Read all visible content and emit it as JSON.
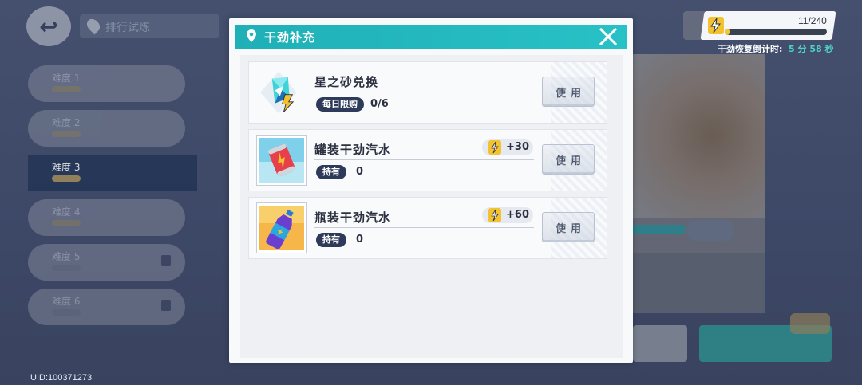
{
  "background": {
    "location_title": "排行试炼",
    "levels": [
      {
        "label": "难度 1",
        "locked": false
      },
      {
        "label": "难度 2",
        "locked": false
      },
      {
        "label": "难度 3",
        "locked": false,
        "active": true
      },
      {
        "label": "难度 4",
        "locked": false
      },
      {
        "label": "难度 5",
        "locked": true
      },
      {
        "label": "难度 6",
        "locked": true
      }
    ],
    "uid": "UID:100371273"
  },
  "stamina": {
    "value": "11/240",
    "fill_fraction": 0.046,
    "timer_label": "干劲恢复倒计时:",
    "timer_value": "5 分 58 秒"
  },
  "modal": {
    "title": "干劲补充",
    "items": [
      {
        "name": "星之砂兑换",
        "icon": "star-sand-crystal-icon",
        "tag": "每日限购",
        "count": "0/6",
        "gain": null,
        "button": "使用"
      },
      {
        "name": "罐装干劲汽水",
        "icon": "canned-soda-icon",
        "tag": "持有",
        "count": "0",
        "gain": "+30",
        "button": "使用"
      },
      {
        "name": "瓶装干劲汽水",
        "icon": "bottled-soda-icon",
        "tag": "持有",
        "count": "0",
        "gain": "+60",
        "button": "使用"
      }
    ]
  },
  "colors": {
    "header_teal": "#22b6bc",
    "tag_navy": "#2e3a5a",
    "timer_teal": "#4fd2c7",
    "bolt_yellow": "#f2c230"
  }
}
